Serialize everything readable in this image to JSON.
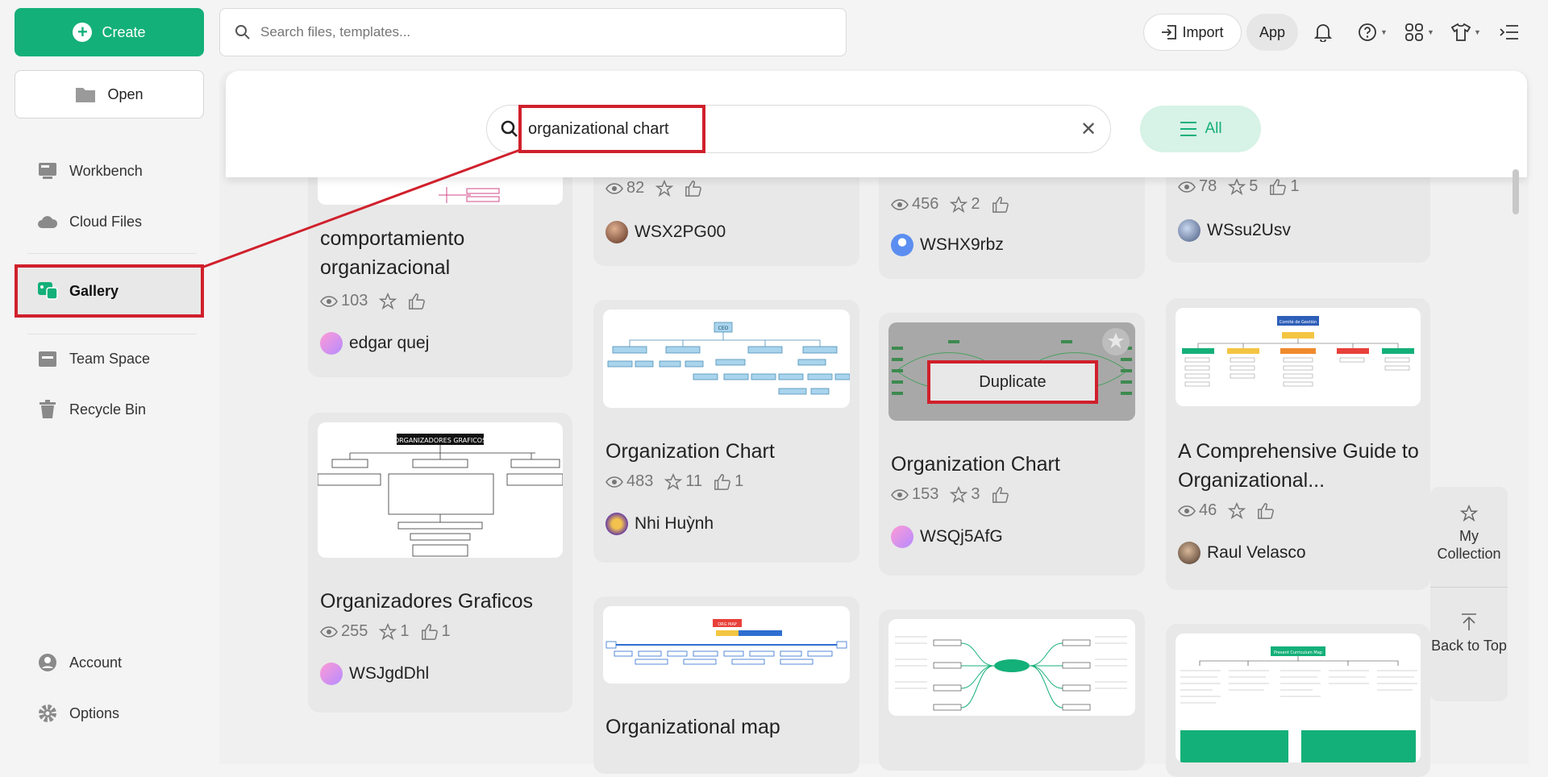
{
  "sidebar": {
    "create_label": "Create",
    "open_label": "Open",
    "items": [
      {
        "label": "Workbench"
      },
      {
        "label": "Cloud Files"
      },
      {
        "label": "Gallery"
      },
      {
        "label": "Team Space"
      },
      {
        "label": "Recycle Bin"
      },
      {
        "label": "Account"
      },
      {
        "label": "Options"
      }
    ]
  },
  "topbar": {
    "search_placeholder": "Search files, templates...",
    "import_label": "Import",
    "app_label": "App"
  },
  "gallery_search": {
    "query": "organizational chart",
    "filter_label": "All"
  },
  "cards": [
    {
      "title": "comportamiento organizacional",
      "views": "103",
      "stars": "",
      "likes": "",
      "author": "edgar quej"
    },
    {
      "title": "",
      "views": "82",
      "stars": "",
      "likes": "",
      "author": "WSX2PG00"
    },
    {
      "title": "",
      "views": "456",
      "stars": "2",
      "likes": "",
      "author": "WSHX9rbz"
    },
    {
      "title": "",
      "views": "78",
      "stars": "5",
      "likes": "1",
      "author": "WSsu2Usv"
    },
    {
      "title": "Organizadores Graficos",
      "views": "255",
      "stars": "1",
      "likes": "1",
      "author": "WSJgdDhl"
    },
    {
      "title": "Organization Chart",
      "views": "483",
      "stars": "11",
      "likes": "1",
      "author": "Nhi Huỳnh"
    },
    {
      "title": "Organization Chart",
      "views": "153",
      "stars": "3",
      "likes": "",
      "author": "WSQj5AfG"
    },
    {
      "title": "A Comprehensive Guide to Organizational...",
      "views": "46",
      "stars": "",
      "likes": "",
      "author": "Raul Velasco"
    },
    {
      "title": "Organizational map",
      "views": "",
      "stars": "",
      "likes": "",
      "author": ""
    }
  ],
  "thumb_texts": {
    "organizadores": "ORGANIZADORES GRAFICOS",
    "org_chart_top": "CEO",
    "guide_top": "Comité de Gestión",
    "curriculum": "Present Curriculum Map",
    "map_top": "ORG MAP"
  },
  "hover_action": "Duplicate",
  "float": {
    "collection_label": "My Collection",
    "top_label": "Back to Top"
  },
  "colors": {
    "brand_green": "#14b079",
    "highlight_red": "#d0202c"
  }
}
